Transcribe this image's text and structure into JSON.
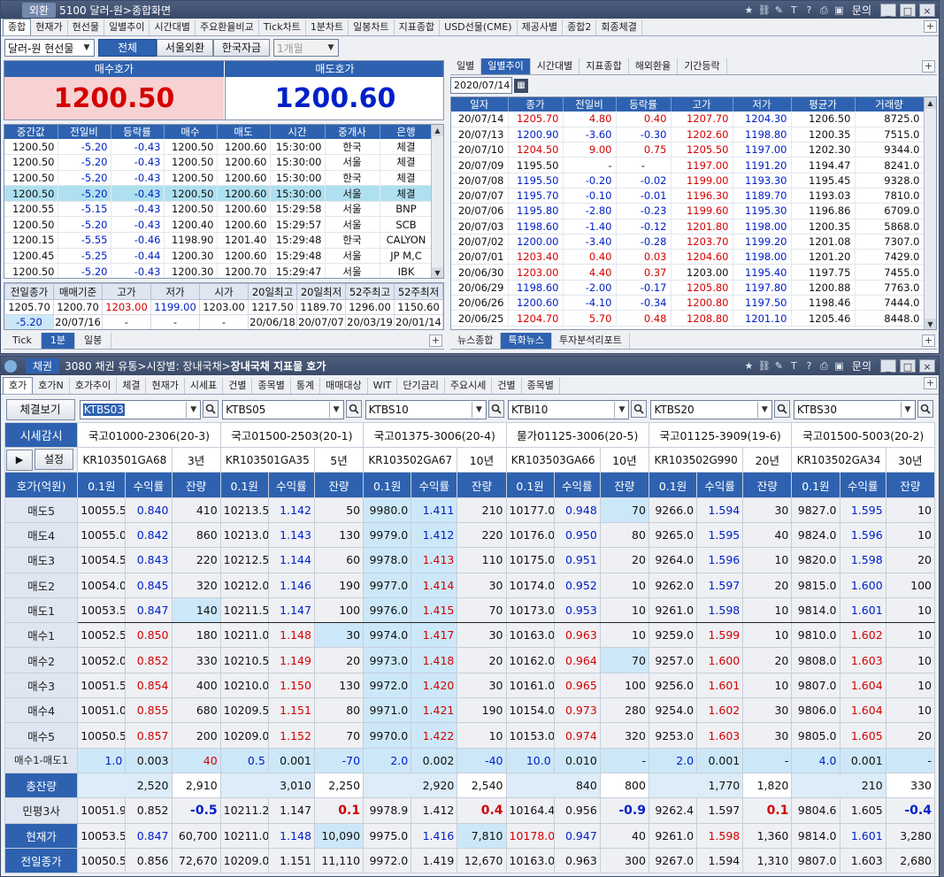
{
  "top": {
    "title_brand": "외환",
    "title_text": "5100 달러-원>종합화면",
    "menu_label": "문의",
    "tabs": [
      "종합",
      "현재가",
      "현선물",
      "일별추이",
      "시간대별",
      "주요환율비교",
      "Tick차트",
      "1분차트",
      "일봉차트",
      "지표종합",
      "USD선물(CME)",
      "제공사별",
      "종합2",
      "회종체결"
    ],
    "market_select": "달러-원 현선물",
    "filter_buttons": [
      "전체",
      "서울외환",
      "한국자금"
    ],
    "period_select": "1개월",
    "bid_label": "매수호가",
    "ask_label": "매도호가",
    "bid_price": "1200.50",
    "ask_price": "1200.60",
    "trade_headers": [
      "중간값",
      "전일비",
      "등락률",
      "매수",
      "매도",
      "시간",
      "중개사",
      "은행"
    ],
    "trades": [
      [
        "1200.50",
        "-5.20",
        "-0.43",
        "1200.50",
        "1200.60",
        "15:30:00",
        "한국",
        "체결"
      ],
      [
        "1200.50",
        "-5.20",
        "-0.43",
        "1200.50",
        "1200.60",
        "15:30:00",
        "서울",
        "체결"
      ],
      [
        "1200.50",
        "-5.20",
        "-0.43",
        "1200.50",
        "1200.60",
        "15:30:00",
        "한국",
        "체결"
      ],
      [
        "1200.50",
        "-5.20",
        "-0.43",
        "1200.50",
        "1200.60",
        "15:30:00",
        "서울",
        "체결"
      ],
      [
        "1200.55",
        "-5.15",
        "-0.43",
        "1200.50",
        "1200.60",
        "15:29:58",
        "서울",
        "BNP"
      ],
      [
        "1200.50",
        "-5.20",
        "-0.43",
        "1200.40",
        "1200.60",
        "15:29:57",
        "서울",
        "SCB"
      ],
      [
        "1200.15",
        "-5.55",
        "-0.46",
        "1198.90",
        "1201.40",
        "15:29:48",
        "한국",
        "CALYON"
      ],
      [
        "1200.45",
        "-5.25",
        "-0.44",
        "1200.30",
        "1200.60",
        "15:29:48",
        "서울",
        "JP M,C"
      ],
      [
        "1200.50",
        "-5.20",
        "-0.43",
        "1200.30",
        "1200.70",
        "15:29:47",
        "서울",
        "IBK"
      ]
    ],
    "summary_headers": [
      "전일종가",
      "매매기준",
      "고가",
      "저가",
      "시가",
      "20일최고",
      "20일최저",
      "52주최고",
      "52주최저"
    ],
    "summary_row1": [
      "1205.70",
      "1200.70",
      "1203.00",
      "1199.00",
      "1203.00",
      "1217.50",
      "1189.70",
      "1296.00",
      "1150.60"
    ],
    "summary_row2": [
      "-5.20",
      "20/07/16",
      "-",
      "-",
      "-",
      "20/06/18",
      "20/07/07",
      "20/03/19",
      "20/01/14"
    ],
    "bottom_tabs_left": [
      "Tick",
      "1분",
      "일봉"
    ],
    "right_tabs": [
      "일별",
      "일별추이",
      "시간대별",
      "지표종합",
      "해외환율",
      "기간등락"
    ],
    "date_input": "2020/07/14",
    "daily_headers": [
      "일자",
      "종가",
      "전일비",
      "등락률",
      "고가",
      "저가",
      "평균가",
      "거래량"
    ],
    "daily": [
      [
        "20/07/14",
        "1205.70",
        "4.80",
        "0.40",
        "1207.70",
        "1204.30",
        "1206.50",
        "8725.0"
      ],
      [
        "20/07/13",
        "1200.90",
        "-3.60",
        "-0.30",
        "1202.60",
        "1198.80",
        "1200.35",
        "7515.0"
      ],
      [
        "20/07/10",
        "1204.50",
        "9.00",
        "0.75",
        "1205.50",
        "1197.00",
        "1202.30",
        "9344.0"
      ],
      [
        "20/07/09",
        "1195.50",
        "-",
        "-",
        "1197.00",
        "1191.20",
        "1194.47",
        "8241.0"
      ],
      [
        "20/07/08",
        "1195.50",
        "-0.20",
        "-0.02",
        "1199.00",
        "1193.30",
        "1195.45",
        "9328.0"
      ],
      [
        "20/07/07",
        "1195.70",
        "-0.10",
        "-0.01",
        "1196.30",
        "1189.70",
        "1193.03",
        "7810.0"
      ],
      [
        "20/07/06",
        "1195.80",
        "-2.80",
        "-0.23",
        "1199.60",
        "1195.30",
        "1196.86",
        "6709.0"
      ],
      [
        "20/07/03",
        "1198.60",
        "-1.40",
        "-0.12",
        "1201.80",
        "1198.00",
        "1200.35",
        "5868.0"
      ],
      [
        "20/07/02",
        "1200.00",
        "-3.40",
        "-0.28",
        "1203.70",
        "1199.20",
        "1201.08",
        "7307.0"
      ],
      [
        "20/07/01",
        "1203.40",
        "0.40",
        "0.03",
        "1204.60",
        "1198.00",
        "1201.20",
        "7429.0"
      ],
      [
        "20/06/30",
        "1203.00",
        "4.40",
        "0.37",
        "1203.00",
        "1195.40",
        "1197.75",
        "7455.0"
      ],
      [
        "20/06/29",
        "1198.60",
        "-2.00",
        "-0.17",
        "1205.80",
        "1197.80",
        "1200.88",
        "7763.0"
      ],
      [
        "20/06/26",
        "1200.60",
        "-4.10",
        "-0.34",
        "1200.80",
        "1197.50",
        "1198.46",
        "7444.0"
      ],
      [
        "20/06/25",
        "1204.70",
        "5.70",
        "0.48",
        "1208.80",
        "1201.10",
        "1205.46",
        "8448.0"
      ]
    ],
    "news_tabs": [
      "뉴스종합",
      "특화뉴스",
      "투자분석리포트"
    ]
  },
  "bond": {
    "title_brand": "채권",
    "title_path": "3080 채권 유통>시장별: 장내국채>",
    "title_bold": "장내국채 지표물 호가",
    "menu_label": "문의",
    "tabs": [
      "호가",
      "호가N",
      "호가추이",
      "체결",
      "현재가",
      "시세표",
      "건별",
      "종목별",
      "통계",
      "매매대상",
      "WIT",
      "단기금리",
      "주요시세",
      "건별",
      "종목별"
    ],
    "btn_trades": "체결보기",
    "btn_market": "시세감시",
    "btn_settings": "설정",
    "col_header": "호가(억원)",
    "row_labels": [
      "매도5",
      "매도4",
      "매도3",
      "매도2",
      "매도1",
      "매수1",
      "매수2",
      "매수3",
      "매수4",
      "매수5",
      "매수1-매도1",
      "총잔량",
      "민평3사",
      "현재가",
      "전일종가"
    ],
    "sub_headers": [
      "0.1원",
      "수익률",
      "잔량"
    ],
    "columns": [
      {
        "code": "KTBS03",
        "name": "국고01000-2306(20-3)",
        "isin": "KR103501GA68",
        "term": "3년",
        "rows": [
          [
            "10055.5",
            "0.840",
            "410"
          ],
          [
            "10055.0",
            "0.842",
            "860"
          ],
          [
            "10054.5",
            "0.843",
            "220"
          ],
          [
            "10054.0",
            "0.845",
            "320"
          ],
          [
            "10053.5",
            "0.847",
            "140"
          ],
          [
            "10052.5",
            "0.850",
            "180"
          ],
          [
            "10052.0",
            "0.852",
            "330"
          ],
          [
            "10051.5",
            "0.854",
            "400"
          ],
          [
            "10051.0",
            "0.855",
            "680"
          ],
          [
            "10050.5",
            "0.857",
            "200"
          ],
          [
            "1.0",
            "0.003",
            "40"
          ]
        ],
        "totals": [
          "2,520",
          "2,910"
        ],
        "mp": [
          "10051.9",
          "0.852",
          "-0.5"
        ],
        "cur": [
          "10053.5",
          "0.847",
          "60,700"
        ],
        "prev": [
          "10050.5",
          "0.856",
          "72,670"
        ]
      },
      {
        "code": "KTBS05",
        "name": "국고01500-2503(20-1)",
        "isin": "KR103501GA35",
        "term": "5년",
        "rows": [
          [
            "10213.5",
            "1.142",
            "50"
          ],
          [
            "10213.0",
            "1.143",
            "130"
          ],
          [
            "10212.5",
            "1.144",
            "60"
          ],
          [
            "10212.0",
            "1.146",
            "190"
          ],
          [
            "10211.5",
            "1.147",
            "100"
          ],
          [
            "10211.0",
            "1.148",
            "30"
          ],
          [
            "10210.5",
            "1.149",
            "20"
          ],
          [
            "10210.0",
            "1.150",
            "130"
          ],
          [
            "10209.5",
            "1.151",
            "80"
          ],
          [
            "10209.0",
            "1.152",
            "70"
          ],
          [
            "0.5",
            "0.001",
            "-70"
          ]
        ],
        "totals": [
          "3,010",
          "2,250"
        ],
        "mp": [
          "10211.2",
          "1.147",
          "0.1"
        ],
        "cur": [
          "10211.0",
          "1.148",
          "10,090"
        ],
        "prev": [
          "10209.0",
          "1.151",
          "11,110"
        ]
      },
      {
        "code": "KTBS10",
        "name": "국고01375-3006(20-4)",
        "isin": "KR103502GA67",
        "term": "10년",
        "rows": [
          [
            "9980.0",
            "1.411",
            "210"
          ],
          [
            "9979.0",
            "1.412",
            "220"
          ],
          [
            "9978.0",
            "1.413",
            "110"
          ],
          [
            "9977.0",
            "1.414",
            "30"
          ],
          [
            "9976.0",
            "1.415",
            "70"
          ],
          [
            "9974.0",
            "1.417",
            "30"
          ],
          [
            "9973.0",
            "1.418",
            "20"
          ],
          [
            "9972.0",
            "1.420",
            "30"
          ],
          [
            "9971.0",
            "1.421",
            "190"
          ],
          [
            "9970.0",
            "1.422",
            "10"
          ],
          [
            "2.0",
            "0.002",
            "-40"
          ]
        ],
        "totals": [
          "2,920",
          "2,540"
        ],
        "mp": [
          "9978.9",
          "1.412",
          "0.4"
        ],
        "cur": [
          "9975.0",
          "1.416",
          "7,810"
        ],
        "prev": [
          "9972.0",
          "1.419",
          "12,670"
        ]
      },
      {
        "code": "KTBI10",
        "name": "물가01125-3006(20-5)",
        "isin": "KR103503GA66",
        "term": "10년",
        "rows": [
          [
            "10177.0",
            "0.948",
            "70"
          ],
          [
            "10176.0",
            "0.950",
            "80"
          ],
          [
            "10175.0",
            "0.951",
            "20"
          ],
          [
            "10174.0",
            "0.952",
            "10"
          ],
          [
            "10173.0",
            "0.953",
            "10"
          ],
          [
            "10163.0",
            "0.963",
            "10"
          ],
          [
            "10162.0",
            "0.964",
            "70"
          ],
          [
            "10161.0",
            "0.965",
            "100"
          ],
          [
            "10154.0",
            "0.973",
            "280"
          ],
          [
            "10153.0",
            "0.974",
            "320"
          ],
          [
            "10.0",
            "0.010",
            "-"
          ]
        ],
        "totals": [
          "840",
          "800"
        ],
        "mp": [
          "10164.4",
          "0.956",
          "-0.9"
        ],
        "cur": [
          "10178.0",
          "0.947",
          "40"
        ],
        "prev": [
          "10163.0",
          "0.963",
          "300"
        ]
      },
      {
        "code": "KTBS20",
        "name": "국고01125-3909(19-6)",
        "isin": "KR103502G990",
        "term": "20년",
        "rows": [
          [
            "9266.0",
            "1.594",
            "30"
          ],
          [
            "9265.0",
            "1.595",
            "40"
          ],
          [
            "9264.0",
            "1.596",
            "10"
          ],
          [
            "9262.0",
            "1.597",
            "20"
          ],
          [
            "9261.0",
            "1.598",
            "10"
          ],
          [
            "9259.0",
            "1.599",
            "10"
          ],
          [
            "9257.0",
            "1.600",
            "20"
          ],
          [
            "9256.0",
            "1.601",
            "10"
          ],
          [
            "9254.0",
            "1.602",
            "30"
          ],
          [
            "9253.0",
            "1.603",
            "30"
          ],
          [
            "2.0",
            "0.001",
            "-"
          ]
        ],
        "totals": [
          "1,770",
          "1,820"
        ],
        "mp": [
          "9262.4",
          "1.597",
          "0.1"
        ],
        "cur": [
          "9261.0",
          "1.598",
          "1,360"
        ],
        "prev": [
          "9267.0",
          "1.594",
          "1,310"
        ]
      },
      {
        "code": "KTBS30",
        "name": "국고01500-5003(20-2)",
        "isin": "KR103502GA34",
        "term": "30년",
        "rows": [
          [
            "9827.0",
            "1.595",
            "10"
          ],
          [
            "9824.0",
            "1.596",
            "10"
          ],
          [
            "9820.0",
            "1.598",
            "20"
          ],
          [
            "9815.0",
            "1.600",
            "100"
          ],
          [
            "9814.0",
            "1.601",
            "10"
          ],
          [
            "9810.0",
            "1.602",
            "10"
          ],
          [
            "9808.0",
            "1.603",
            "10"
          ],
          [
            "9807.0",
            "1.604",
            "10"
          ],
          [
            "9806.0",
            "1.604",
            "10"
          ],
          [
            "9805.0",
            "1.605",
            "20"
          ],
          [
            "4.0",
            "0.001",
            "-"
          ]
        ],
        "totals": [
          "210",
          "330"
        ],
        "mp": [
          "9804.6",
          "1.605",
          "-0.4"
        ],
        "cur": [
          "9814.0",
          "1.601",
          "3,280"
        ],
        "prev": [
          "9807.0",
          "1.603",
          "2,680"
        ]
      }
    ]
  },
  "colors": {
    "title": "#3d4d6c",
    "accent": "#2e62b0",
    "up": "#d40000",
    "down": "#0020c8",
    "highlight": "#cce8f8",
    "bid_bg": "#f8d2d2"
  }
}
